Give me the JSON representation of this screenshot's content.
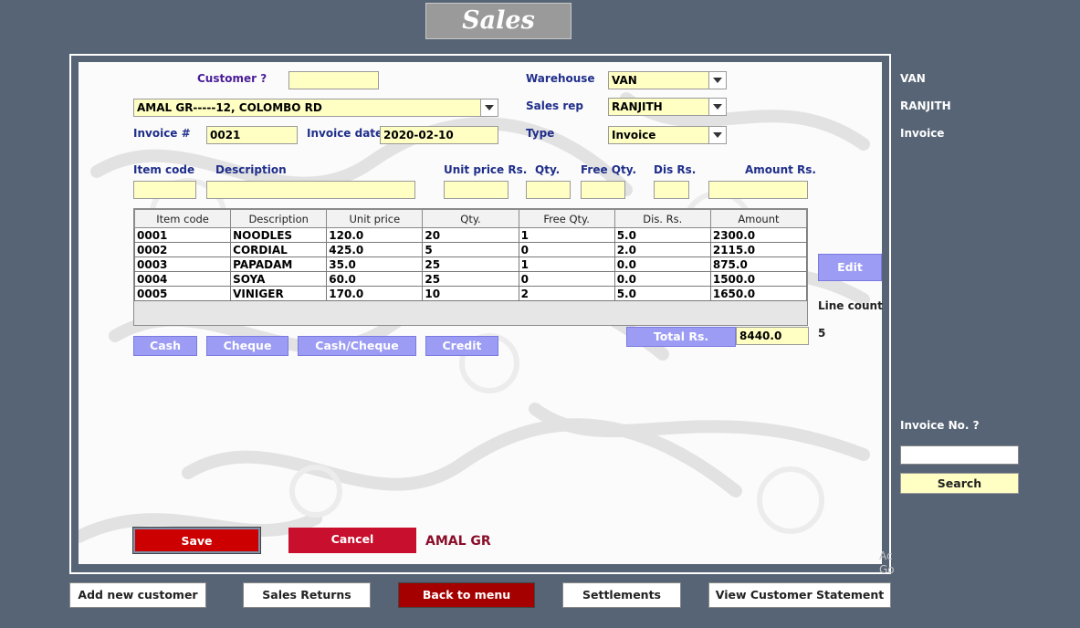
{
  "title": "Sales",
  "header": {
    "customer_label": "Customer  ?",
    "customer_query": "",
    "customer_select": "AMAL GR-----12, COLOMBO RD",
    "warehouse_label": "Warehouse",
    "warehouse_value": "VAN",
    "sales_rep_label": "Sales rep",
    "sales_rep_value": "RANJITH",
    "type_label": "Type",
    "type_value": "Invoice",
    "invoice_no_label": "Invoice #",
    "invoice_no_value": "0021",
    "invoice_date_label": "Invoice date",
    "invoice_date_value": "2020-02-10"
  },
  "entry": {
    "item_code_label": "Item code",
    "description_label": "Description",
    "unit_price_label": "Unit price Rs.",
    "qty_label": "Qty.",
    "free_qty_label": "Free Qty.",
    "dis_label": "Dis Rs.",
    "amount_label": "Amount Rs."
  },
  "table": {
    "columns": [
      "Item code",
      "Description",
      "Unit price",
      "Qty.",
      "Free Qty.",
      "Dis. Rs.",
      "Amount"
    ],
    "rows": [
      [
        "0001",
        "NOODLES",
        "120.0",
        "20",
        "1",
        "5.0",
        "2300.0"
      ],
      [
        "0002",
        "CORDIAL",
        "425.0",
        "5",
        "0",
        "2.0",
        "2115.0"
      ],
      [
        "0003",
        "PAPADAM",
        "35.0",
        "25",
        "1",
        "0.0",
        "875.0"
      ],
      [
        "0004",
        "SOYA",
        "60.0",
        "25",
        "0",
        "0.0",
        "1500.0"
      ],
      [
        "0005",
        "VINIGER",
        "170.0",
        "10",
        "2",
        "5.0",
        "1650.0"
      ]
    ]
  },
  "payment": {
    "cash": "Cash",
    "cheque": "Cheque",
    "cash_cheque": "Cash/Cheque",
    "credit": "Credit"
  },
  "totals": {
    "total_label": "Total Rs.",
    "total_value": "8440.0",
    "line_count_label": "Line count",
    "line_count_value": "5"
  },
  "actions": {
    "edit": "Edit",
    "save": "Save",
    "cancel": "Cancel",
    "customer_name": "AMAL GR"
  },
  "side": {
    "warehouse": "VAN",
    "sales_rep": "RANJITH",
    "type": "Invoice",
    "invoice_search_label": "Invoice  No. ?",
    "invoice_search_value": "",
    "search_button": "Search"
  },
  "watermark": "Ac\nGo",
  "bottom_nav": {
    "add_customer": "Add new customer",
    "sales_returns": "Sales Returns",
    "back_to_menu": "Back to menu",
    "settlements": "Settlements",
    "view_statement": "View Customer Statement"
  },
  "colors": {
    "background": "#566475",
    "field": "#ffffc4",
    "accent_button": "#9c9cf5",
    "danger": "#cc0000",
    "label": "#1f2e8a"
  }
}
